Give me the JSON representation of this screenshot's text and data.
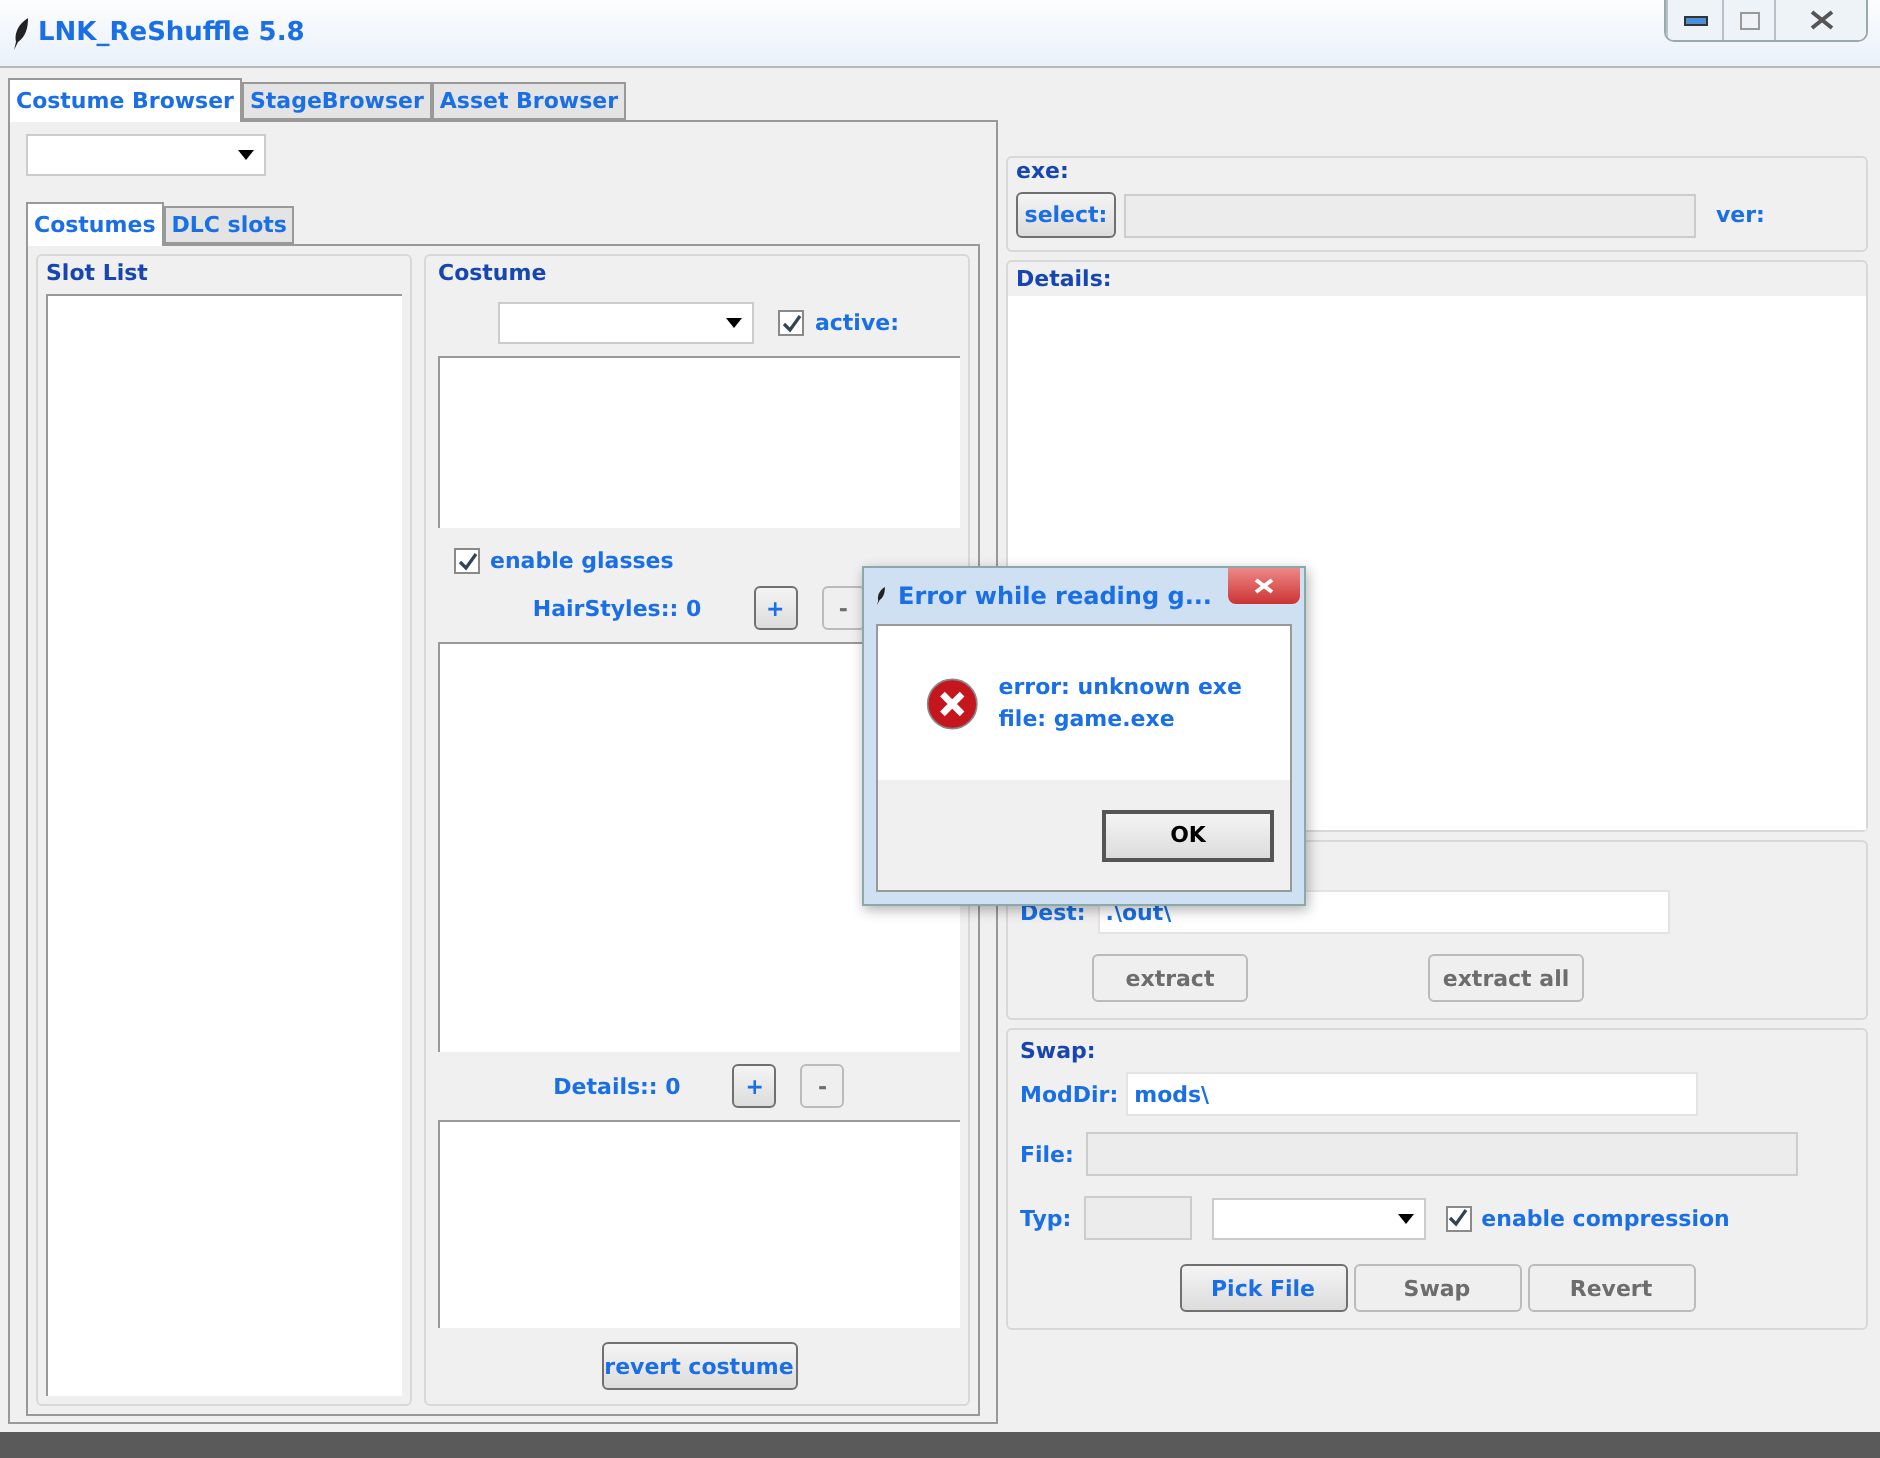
{
  "window": {
    "title": "LNK_ReShuffle 5.8"
  },
  "tabs": [
    {
      "label": "Costume Browser",
      "selected": true
    },
    {
      "label": "StageBrowser",
      "selected": false
    },
    {
      "label": "Asset Browser",
      "selected": false
    }
  ],
  "subtabs": [
    {
      "label": "Costumes",
      "selected": true
    },
    {
      "label": "DLC slots",
      "selected": false
    }
  ],
  "slot_list": {
    "title": "Slot List"
  },
  "costume": {
    "title": "Costume",
    "active": {
      "label": "active:",
      "checked": true
    },
    "glasses": {
      "label": "enable glasses",
      "checked": true
    },
    "hairstyles": {
      "label": "HairStyles:: 0",
      "add": {
        "label": "+",
        "disabled": false
      },
      "remove": {
        "label": "-",
        "disabled": true
      }
    },
    "details": {
      "label": "Details:: 0",
      "add": {
        "label": "+",
        "disabled": false
      },
      "remove": {
        "label": "-",
        "disabled": true
      }
    },
    "revert": {
      "label": "revert costume",
      "disabled": false
    }
  },
  "exe": {
    "title": "exe:",
    "select": {
      "label": "select:",
      "disabled": false
    },
    "ver": "ver:"
  },
  "details": {
    "title": "Details:"
  },
  "extract": {
    "dest_label": "Dest:",
    "dest_value": ".\\out\\",
    "buttons": [
      {
        "label": "extract",
        "disabled": true
      },
      {
        "label": "extract all",
        "disabled": true
      }
    ]
  },
  "swap": {
    "title": "Swap:",
    "moddir_label": "ModDir:",
    "moddir_value": "mods\\",
    "file_label": "File:",
    "typ_label": "Typ:",
    "compression": {
      "label": "enable compression",
      "checked": true
    },
    "buttons": [
      {
        "label": "Pick File",
        "disabled": false
      },
      {
        "label": "Swap",
        "disabled": true
      },
      {
        "label": "Revert",
        "disabled": true
      }
    ]
  },
  "dialog": {
    "title": "Error while reading g...",
    "lines": [
      "error: unknown exe",
      "file: game.exe"
    ],
    "button": "OK"
  }
}
